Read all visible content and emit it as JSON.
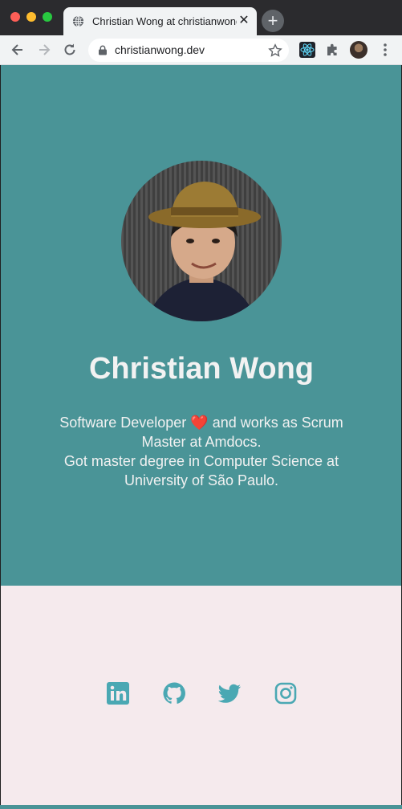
{
  "browser": {
    "tab_title": "Christian Wong at christianwong",
    "tab_close": "✕",
    "new_tab": "+",
    "url": "christianwong.dev"
  },
  "profile": {
    "name": "Christian Wong",
    "bio_part1": "Software Developer ",
    "heart": "❤️",
    "bio_part2": " and works as Scrum Master at Amdocs.",
    "bio_line2": "Got master degree in Computer Science at University of São Paulo."
  },
  "colors": {
    "hero_bg": "#4a9497",
    "footer_bg": "#f5eaed",
    "social_icon": "#4aa8b3"
  },
  "social_icons": [
    "linkedin-icon",
    "github-icon",
    "twitter-icon",
    "instagram-icon"
  ]
}
